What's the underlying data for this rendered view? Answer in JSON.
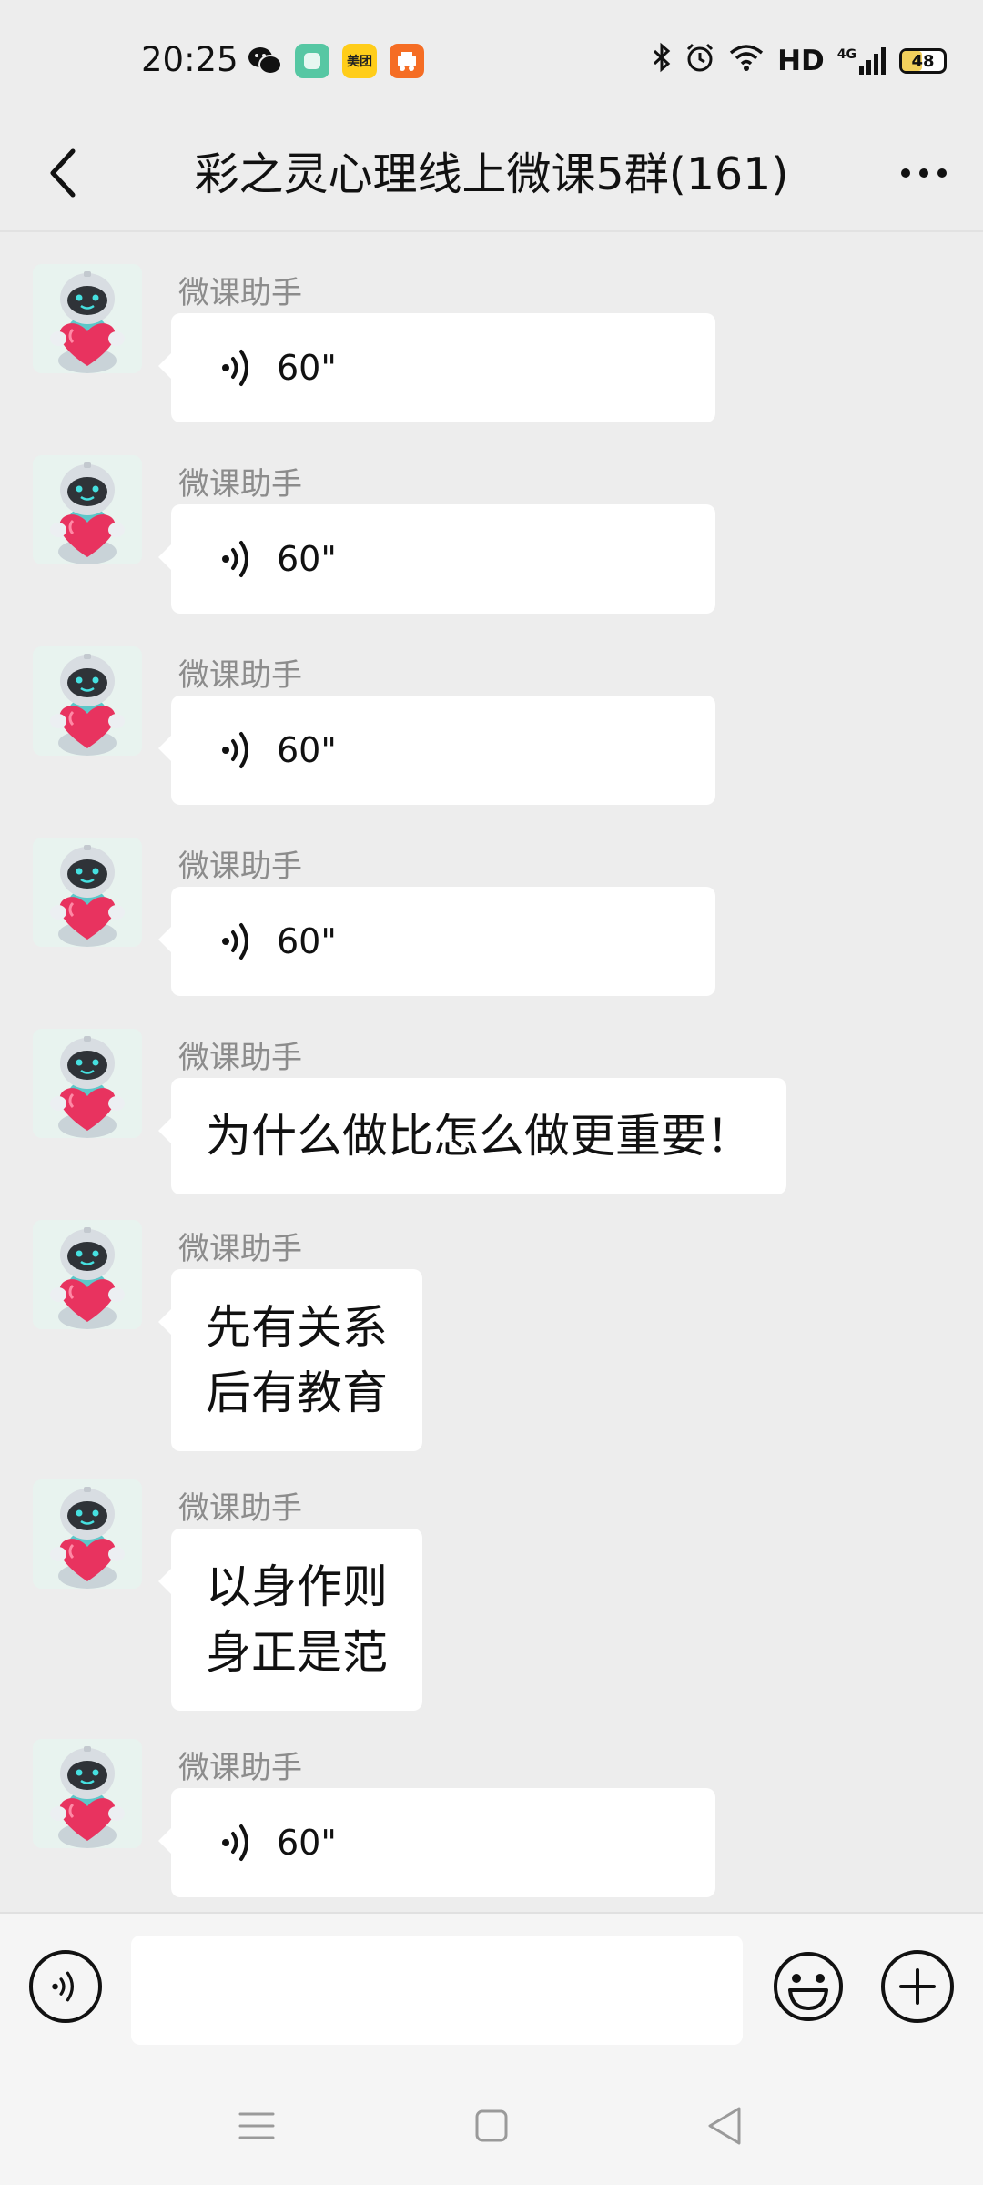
{
  "status_bar": {
    "time": "20:25",
    "app_icons": [
      "wechat-icon",
      "green-app-icon",
      "meituan-icon",
      "orange-app-icon"
    ],
    "meituan_label": "美团",
    "hd_label": "HD",
    "network_label": "4G",
    "battery_level": "48"
  },
  "header": {
    "title": "彩之灵心理线上微课5群(161)"
  },
  "messages": [
    {
      "sender": "微课助手",
      "type": "voice",
      "duration": "60\""
    },
    {
      "sender": "微课助手",
      "type": "voice",
      "duration": "60\""
    },
    {
      "sender": "微课助手",
      "type": "voice",
      "duration": "60\""
    },
    {
      "sender": "微课助手",
      "type": "voice",
      "duration": "60\""
    },
    {
      "sender": "微课助手",
      "type": "text",
      "lines": [
        "为什么做比怎么做更重要！"
      ]
    },
    {
      "sender": "微课助手",
      "type": "text",
      "lines": [
        "先有关系",
        "后有教育"
      ]
    },
    {
      "sender": "微课助手",
      "type": "text",
      "lines": [
        "以身作则",
        "身正是范"
      ]
    },
    {
      "sender": "微课助手",
      "type": "voice",
      "duration": "60\""
    }
  ],
  "input_bar": {
    "placeholder": ""
  },
  "colors": {
    "background": "#ededed",
    "bubble": "#ffffff",
    "sender_name": "#8c8c8c",
    "avatar_heart": "#e8335f"
  }
}
